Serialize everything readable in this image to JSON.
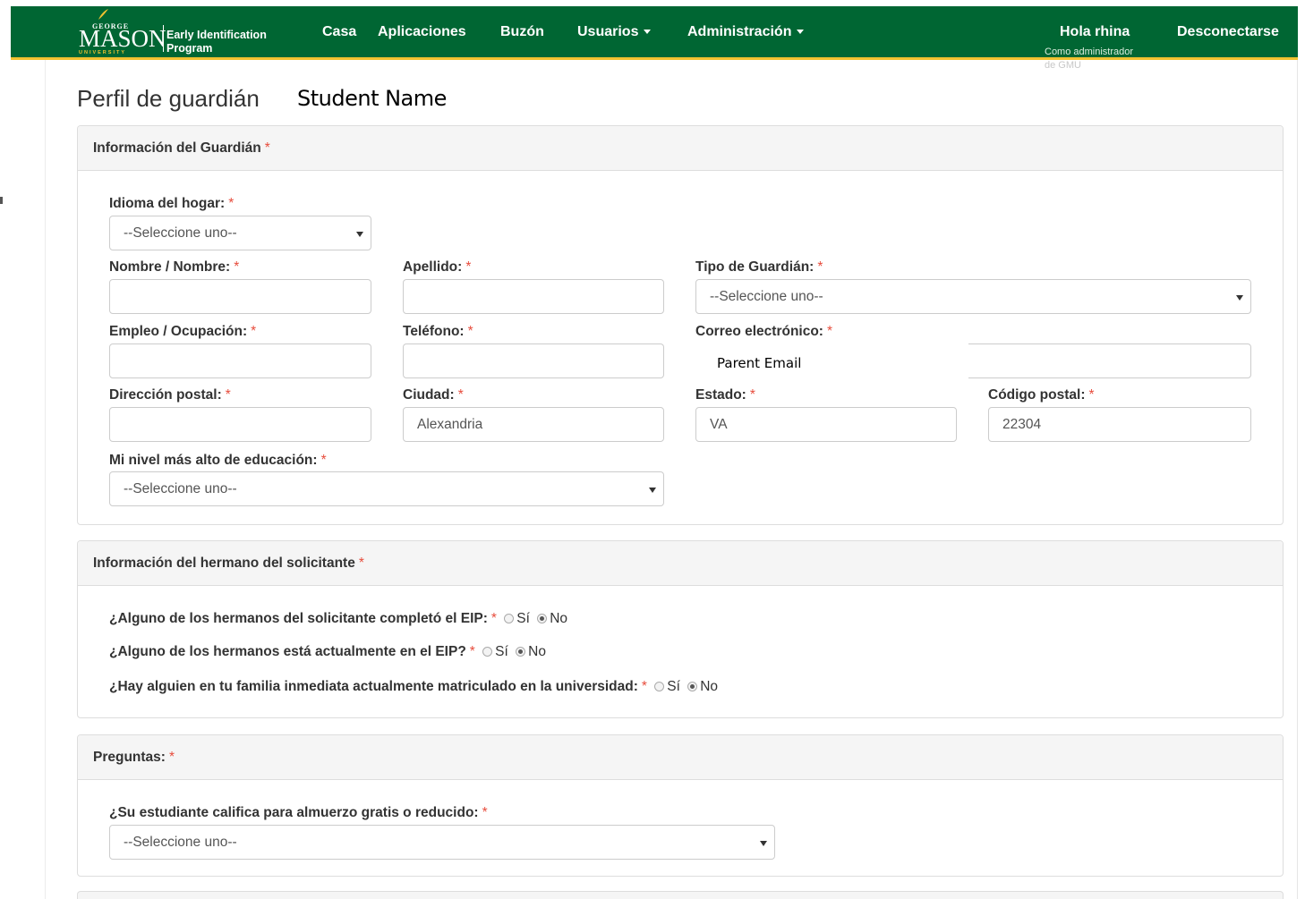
{
  "brand": {
    "university_top": "GEORGE",
    "university_main": "MASON",
    "university_bottom": "UNIVERSITY",
    "program_line1": "Early Identification",
    "program_line2": "Program"
  },
  "nav": {
    "items": [
      {
        "label": "Casa"
      },
      {
        "label": "Aplicaciones"
      },
      {
        "label": "Buzón"
      },
      {
        "label": "Usuarios"
      },
      {
        "label": "Administración"
      }
    ],
    "greeting": "Hola rhina",
    "role_line1": "Como administrador",
    "role_line2": "de GMU",
    "logout": "Desconectarse"
  },
  "page": {
    "title": "Perfil de guardián",
    "student_name": "Student Name"
  },
  "guardian": {
    "heading": "Información del Guardián",
    "required_mark": "*",
    "language_label": "Idioma del hogar:",
    "language_value": "--Seleccione uno--",
    "first_name_label": "Nombre / Nombre:",
    "first_name_value": "",
    "last_name_label": "Apellido:",
    "last_name_value": "",
    "guardian_type_label": "Tipo de Guardián:",
    "guardian_type_value": "--Seleccione uno--",
    "occupation_label": "Empleo / Ocupación:",
    "occupation_value": "",
    "phone_label": "Teléfono:",
    "phone_value": "",
    "email_label": "Correo electrónico:",
    "email_value": "Parent Email",
    "address_label": "Dirección postal:",
    "address_value": "",
    "city_label": "Ciudad:",
    "city_value": "Alexandria",
    "state_label": "Estado:",
    "state_value": "VA",
    "zip_label": "Código postal:",
    "zip_value": "22304",
    "education_label": "Mi nivel más alto de educación:",
    "education_value": "--Seleccione uno--"
  },
  "siblings": {
    "heading": "Información del hermano del solicitante",
    "yes": "Sí",
    "no": "No",
    "questions": [
      {
        "text": "¿Alguno de los hermanos del solicitante completó el EIP:",
        "selected": "No"
      },
      {
        "text": "¿Alguno de los hermanos está actualmente en el EIP?",
        "selected": "No"
      },
      {
        "text": "¿Hay alguien en tu familia inmediata actualmente matriculado en la universidad:",
        "selected": "No"
      }
    ]
  },
  "questions": {
    "heading": "Preguntas:",
    "lunch_label": "¿Su estudiante califica para almuerzo gratis o reducido:",
    "lunch_value": "--Seleccione uno--"
  },
  "colors": {
    "navbar": "#006633",
    "accent_gold": "#f2c230",
    "required": "#e74c3c"
  }
}
